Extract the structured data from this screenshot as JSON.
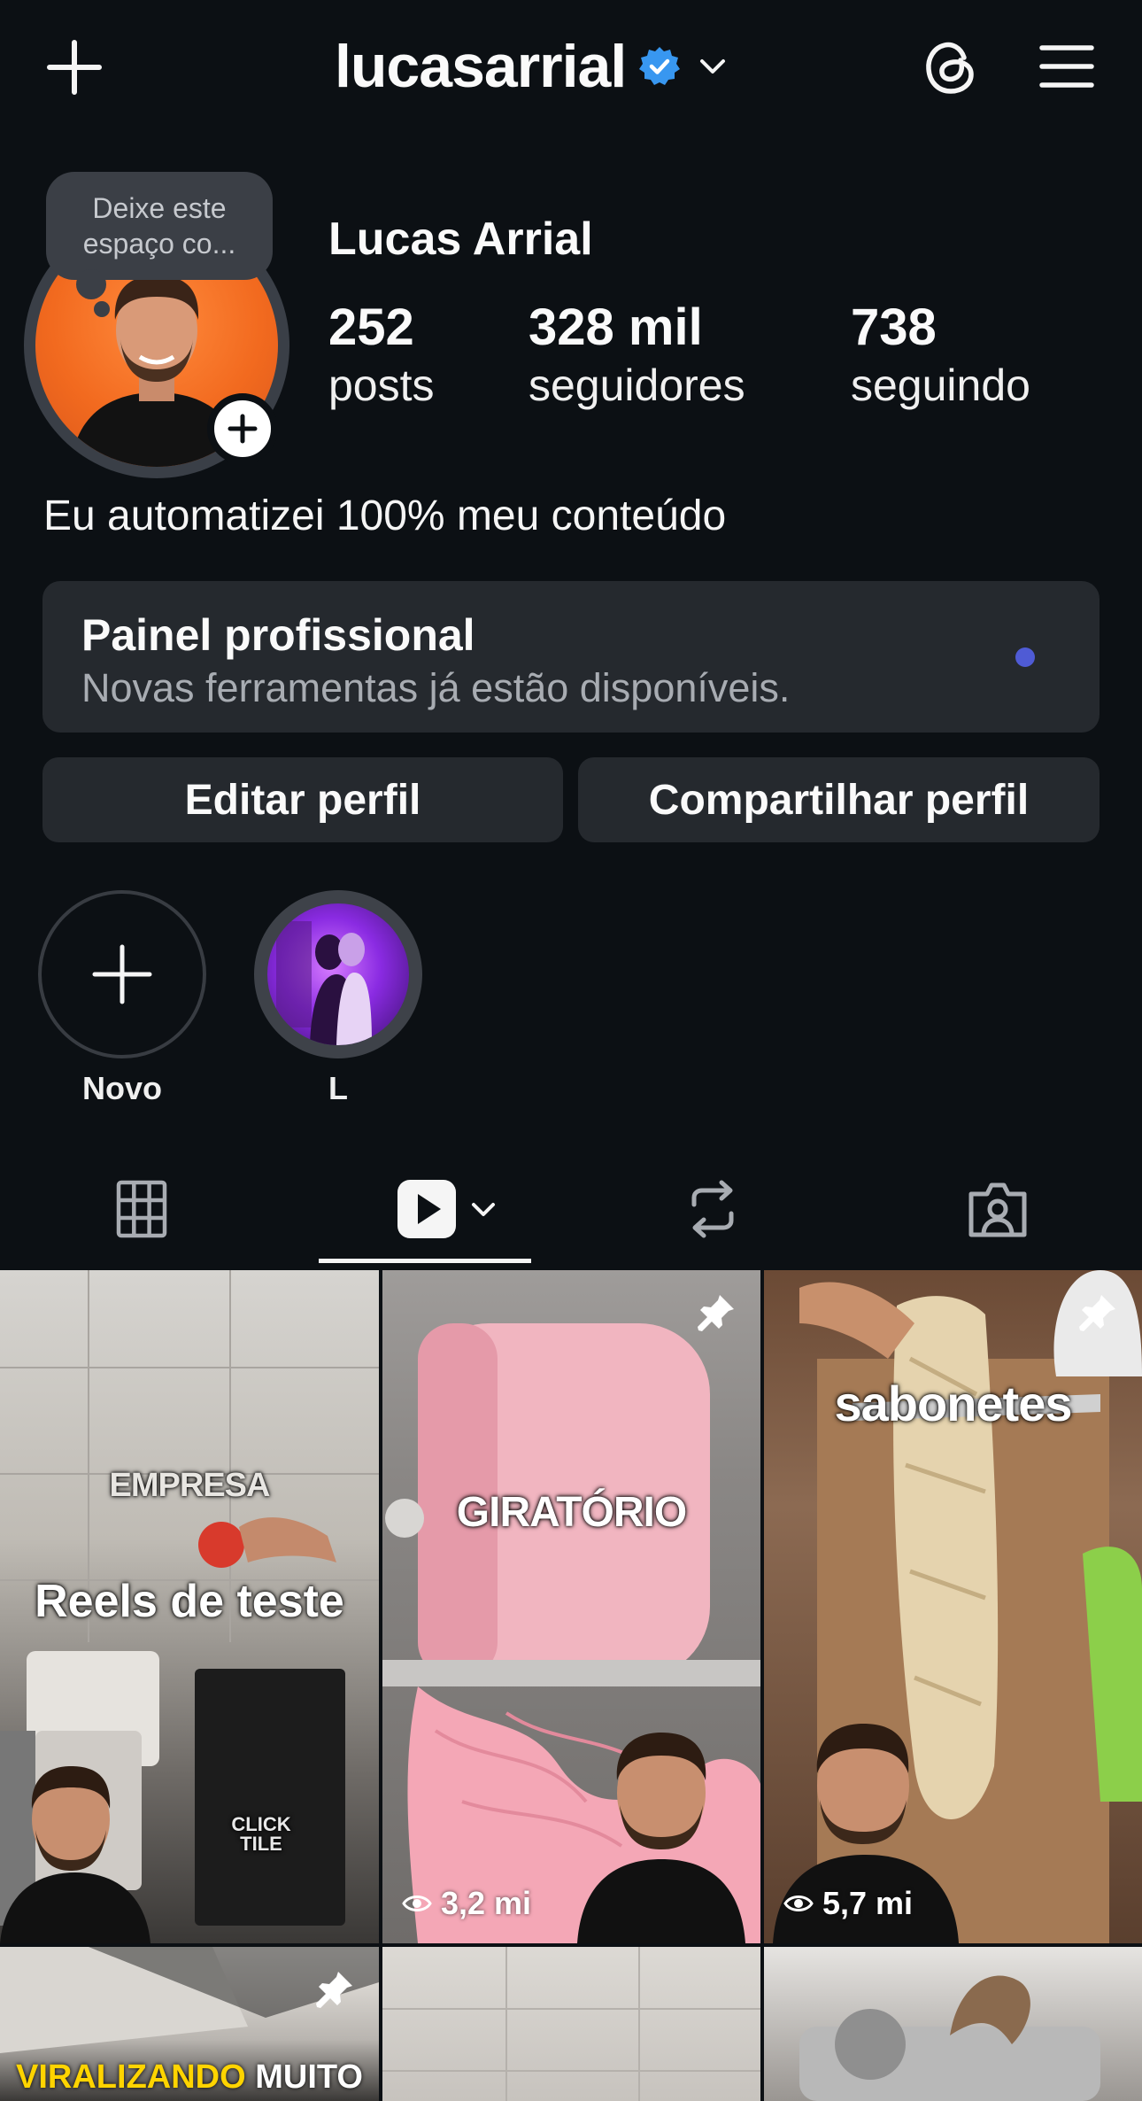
{
  "header": {
    "username": "lucasarrial",
    "verified": true
  },
  "profile": {
    "name": "Lucas Arrial",
    "note": "Deixe este espaço co...",
    "stats": [
      {
        "value": "252",
        "label": "posts"
      },
      {
        "value": "328 mil",
        "label": "seguidores"
      },
      {
        "value": "738",
        "label": "seguindo"
      }
    ],
    "bio": "Eu automatizei 100% meu conteúdo"
  },
  "pro_dashboard": {
    "title": "Painel profissional",
    "subtitle": "Novas ferramentas já estão disponíveis."
  },
  "buttons": {
    "edit": "Editar perfil",
    "share": "Compartilhar perfil"
  },
  "highlights": [
    {
      "label": "Novo"
    },
    {
      "label": "L"
    }
  ],
  "tabs": [
    "grid-tab",
    "reels-tab",
    "reposts-tab",
    "tagged-tab"
  ],
  "grid": [
    {
      "caption": "Reels de teste",
      "overlay": "EMPRESA",
      "brand": "CLICK TILE",
      "views": "",
      "pinned": false
    },
    {
      "caption": "GIRATÓRIO",
      "views": "3,2 mi",
      "pinned": true
    },
    {
      "caption": "sabonetes",
      "views": "5,7 mi",
      "pinned": true
    },
    {
      "caption_a": "VIRALIZANDO",
      "caption_b": "MUITO",
      "pinned": true
    }
  ],
  "colors": {
    "background": "#0c1014",
    "card": "#25292e",
    "accent_dot": "#4f5bd5",
    "verified": "#3897f0",
    "caption_yellow": "#ffd400"
  }
}
